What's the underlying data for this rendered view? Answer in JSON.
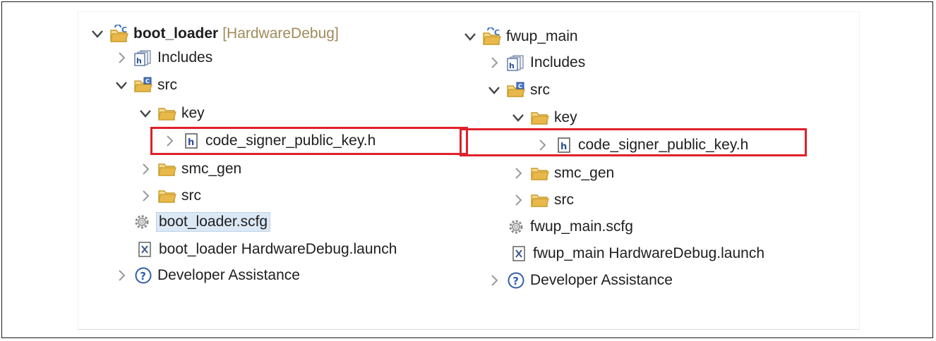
{
  "left_tree": {
    "project": {
      "name": "boot_loader",
      "decoration": "[HardwareDebug]"
    },
    "includes": "Includes",
    "src": "src",
    "key": "key",
    "key_file": "code_signer_public_key.h",
    "smc_gen": "smc_gen",
    "src_sub": "src",
    "scfg": "boot_loader.scfg",
    "launch": "boot_loader HardwareDebug.launch",
    "assist": "Developer Assistance"
  },
  "right_tree": {
    "project": {
      "name": "fwup_main"
    },
    "includes": "Includes",
    "src": "src",
    "key": "key",
    "key_file": "code_signer_public_key.h",
    "smc_gen": "smc_gen",
    "src_sub": "src",
    "scfg": "fwup_main.scfg",
    "launch": "fwup_main HardwareDebug.launch",
    "assist": "Developer Assistance"
  },
  "colors": {
    "highlight_box": "#e0202a",
    "selection": "#dbe8f5",
    "folder": "#e8b84a"
  },
  "icons": [
    "chevron-down-icon",
    "chevron-right-icon",
    "project-icon",
    "includes-icon",
    "source-folder-icon",
    "folder-icon",
    "header-file-icon",
    "gear-icon",
    "launch-file-icon",
    "help-icon"
  ]
}
